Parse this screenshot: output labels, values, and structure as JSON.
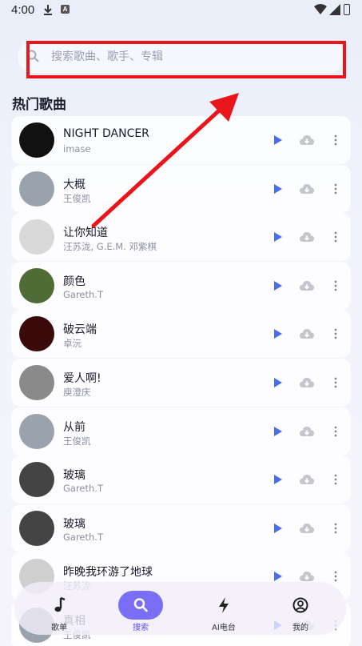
{
  "status_bar": {
    "time": "4:00",
    "a_glyph": "A"
  },
  "search": {
    "placeholder": "搜索歌曲、歌手、专辑"
  },
  "section_title": "热门歌曲",
  "songs": [
    {
      "title": "NIGHT DANCER",
      "artist": "imase",
      "cover": "#111"
    },
    {
      "title": "大概",
      "artist": "王俊凯",
      "cover": "#9aa3ad"
    },
    {
      "title": "让你知道",
      "artist": "汪苏泷, G.E.M. 邓紫棋",
      "cover": "#d9d9d9"
    },
    {
      "title": "颜色",
      "artist": "Gareth.T",
      "cover": "#4f6b36"
    },
    {
      "title": "破云端",
      "artist": "卓沅",
      "cover": "#3a0a0a"
    },
    {
      "title": "爱人啊!",
      "artist": "庾澄庆",
      "cover": "#8a8a8a"
    },
    {
      "title": "从前",
      "artist": "王俊凯",
      "cover": "#9aa3ad"
    },
    {
      "title": "玻璃",
      "artist": "Gareth.T",
      "cover": "#444"
    },
    {
      "title": "玻璃",
      "artist": "Gareth.T",
      "cover": "#444"
    },
    {
      "title": "昨晚我环游了地球",
      "artist": "汪苏泷",
      "cover": "#cfcfcf"
    },
    {
      "title": "真相",
      "artist": "王俊凯",
      "cover": "#9aa3ad"
    }
  ],
  "nav": {
    "playlist": "歌单",
    "search": "搜索",
    "radio": "AI电台",
    "mine": "我的"
  },
  "colors": {
    "accent": "#7a6ef5",
    "play": "#4a6cf0",
    "annotation": "#e8151b"
  }
}
